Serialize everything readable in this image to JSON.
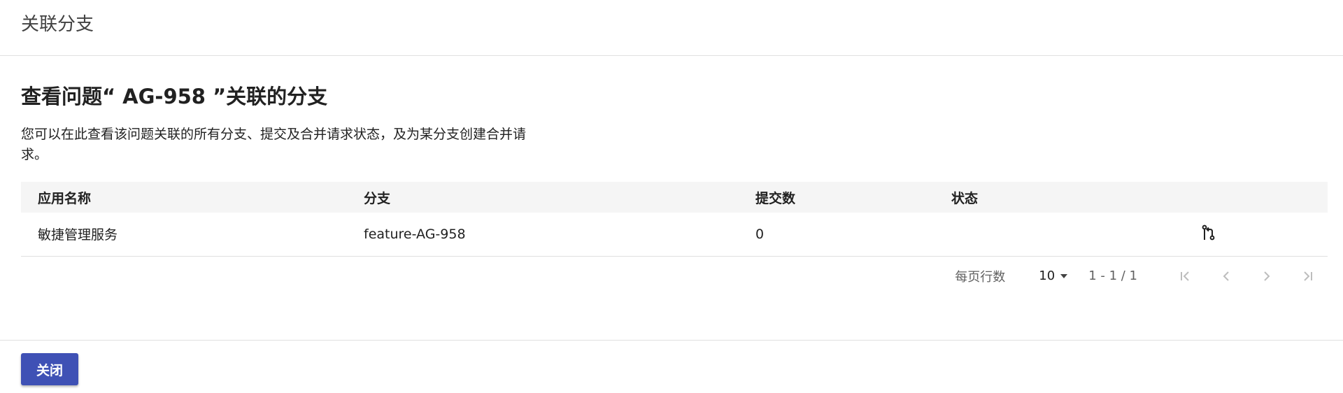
{
  "dialog": {
    "title": "关联分支"
  },
  "content": {
    "heading": "查看问题“ AG-958 ”关联的分支",
    "description": "您可以在此查看该问题关联的所有分支、提交及合并请求状态，及为某分支创建合并请求。"
  },
  "table": {
    "headers": [
      "应用名称",
      "分支",
      "提交数",
      "状态",
      ""
    ],
    "rows": [
      {
        "app_name": "敏捷管理服务",
        "branch": "feature-AG-958",
        "commits": "0",
        "status": "",
        "action_icon": "merge-request-icon"
      }
    ]
  },
  "paginator": {
    "rows_per_page_label": "每页行数",
    "page_size": "10",
    "range": "1 - 1 / 1",
    "icons": [
      "first-page-icon",
      "previous-page-icon",
      "next-page-icon",
      "last-page-icon"
    ]
  },
  "footer": {
    "close_label": "关闭"
  },
  "colors": {
    "primary": "#3f51b5",
    "header_bg": "#f5f5f5",
    "border": "#e0e0e0",
    "disabled_icon": "#bdbdbd"
  }
}
